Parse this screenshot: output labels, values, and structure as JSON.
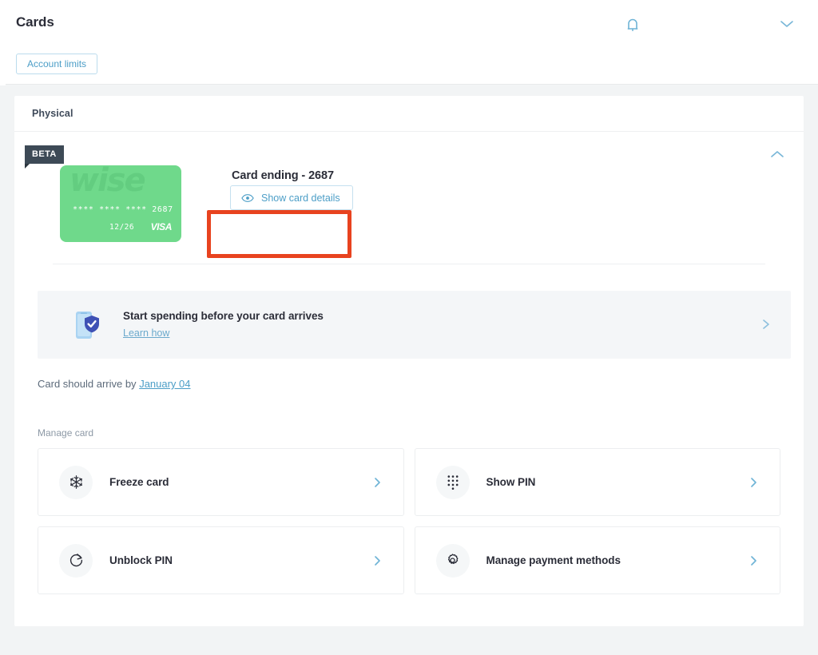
{
  "topbar": {
    "title": "Cards",
    "bell_icon": "bell-icon",
    "profile_chevron_icon": "chevron-down-icon",
    "account_limits_label": "Account limits"
  },
  "panel": {
    "header_label": "Physical",
    "collapse_icon": "chevron-up-icon"
  },
  "card": {
    "beta_badge": "BETA",
    "brand_wordmark": "wise",
    "masked_number": "**** **** **** 2687",
    "expiry": "12/26",
    "network": "VISA",
    "ending_label": "Card ending - 2687",
    "show_details_label": "Show card details",
    "show_details_icon": "eye-icon"
  },
  "annotation": {
    "color": "#e8431f",
    "target": "show-card-details-button"
  },
  "promo": {
    "icon": "phone-shield-check-icon",
    "title": "Start spending before your card arrives",
    "link_label": "Learn how",
    "chevron_icon": "chevron-right-icon"
  },
  "arrival": {
    "prefix": "Card should arrive by",
    "date": "January 04"
  },
  "manage": {
    "section_label": "Manage card",
    "tiles": [
      {
        "label": "Freeze card",
        "icon": "snowflake-icon"
      },
      {
        "label": "Show PIN",
        "icon": "keypad-dots-icon"
      },
      {
        "label": "Unblock PIN",
        "icon": "refresh-icon"
      },
      {
        "label": "Manage payment methods",
        "icon": "gear-icon"
      }
    ]
  },
  "colors": {
    "accent_blue": "#4c9ec7",
    "card_green": "#6fd98b",
    "text_dark": "#2b2d38",
    "page_bg": "#f2f4f5"
  }
}
